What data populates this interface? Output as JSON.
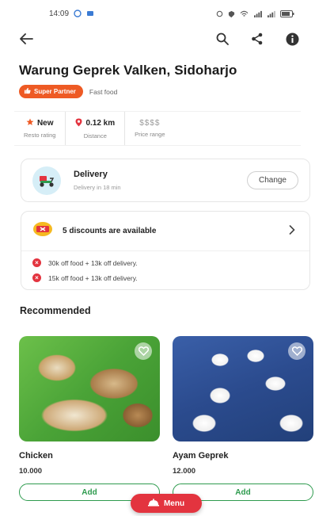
{
  "status_bar": {
    "time": "14:09"
  },
  "restaurant": {
    "name": "Warung Geprek Valken, Sidoharjo",
    "badge": "Super Partner",
    "category": "Fast food"
  },
  "stats": [
    {
      "value": "New",
      "label": "Resto rating"
    },
    {
      "value": "0.12 km",
      "label": "Distance"
    },
    {
      "value": "$$$$",
      "label": "Price range"
    }
  ],
  "delivery": {
    "title": "Delivery",
    "subtitle": "Delivery in 18 min",
    "change_label": "Change"
  },
  "discounts": {
    "headline": "5 discounts are available",
    "items": [
      "30k off food + 13k off delivery.",
      "15k off food + 13k off delivery."
    ]
  },
  "recommended": {
    "title": "Recommended",
    "items": [
      {
        "name": "Chicken",
        "price": "10.000",
        "add_label": "Add"
      },
      {
        "name": "Ayam Geprek",
        "price": "12.000",
        "add_label": "Add"
      }
    ]
  },
  "menu_button": {
    "label": "Menu"
  },
  "colors": {
    "accent": "#ee5a24",
    "discount_red": "#e3343f",
    "add_green": "#2e9b4e"
  },
  "icons": {
    "back": "arrow-left-icon",
    "search": "search-icon",
    "share": "share-icon",
    "info": "info-icon"
  }
}
